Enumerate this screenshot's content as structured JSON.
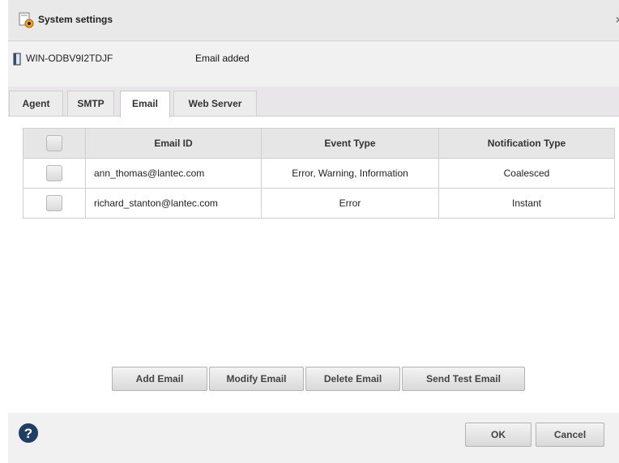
{
  "window": {
    "title": "System settings",
    "close_glyph": "×"
  },
  "info": {
    "server": "WIN-ODBV9I2TDJF",
    "status": "Email added"
  },
  "tabs": [
    {
      "label": "Agent",
      "active": false
    },
    {
      "label": "SMTP",
      "active": false
    },
    {
      "label": "Email",
      "active": true
    },
    {
      "label": "Web Server",
      "active": false
    }
  ],
  "table": {
    "headers": [
      "Email ID",
      "Event Type",
      "Notification Type"
    ],
    "rows": [
      {
        "email": "ann_thomas@lantec.com",
        "event": "Error, Warning, Information",
        "notification": "Coalesced"
      },
      {
        "email": "richard_stanton@lantec.com",
        "event": "Error",
        "notification": "Instant"
      }
    ]
  },
  "actions": {
    "add": "Add Email",
    "modify": "Modify Email",
    "delete": "Delete Email",
    "test": "Send Test Email"
  },
  "footer": {
    "ok": "OK",
    "cancel": "Cancel"
  },
  "icons": {
    "title": "settings-gear-icon",
    "server": "server-icon",
    "help": "help-icon"
  },
  "colors": {
    "help_icon": "#1f3e63",
    "header_bg": "#e6e6e6"
  }
}
